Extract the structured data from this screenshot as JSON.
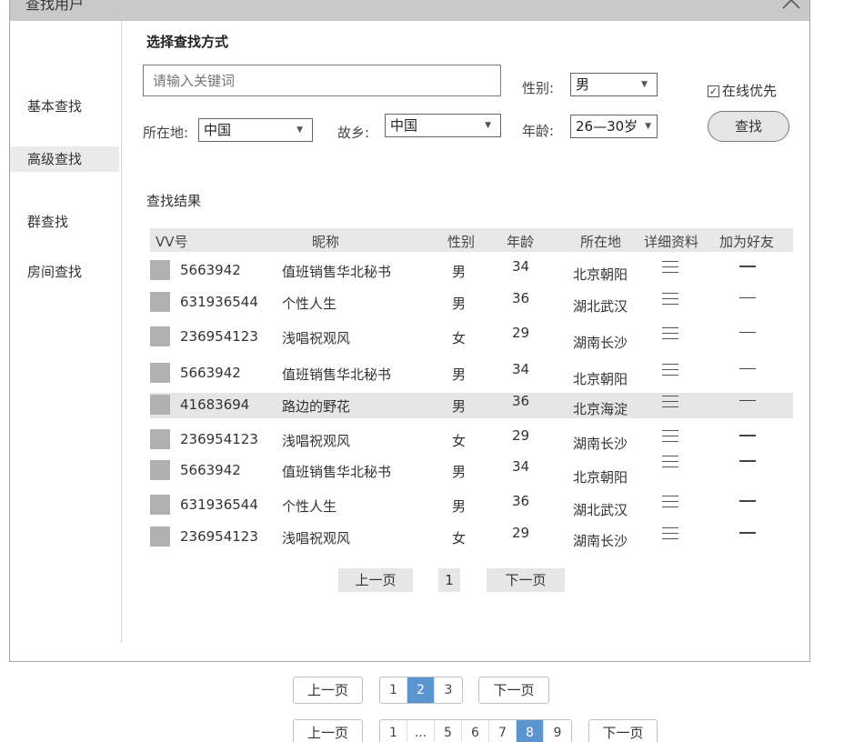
{
  "dialog": {
    "title": "查找用户"
  },
  "sidebar": {
    "items": [
      "基本查找",
      "高级查找",
      "群查找",
      "房间查找"
    ],
    "active": "高级查找"
  },
  "search": {
    "section_title": "选择查找方式",
    "keyword_placeholder": "请输入关键词",
    "gender_label": "性别:",
    "gender_value": "男",
    "location_label": "所在地:",
    "location_value": "中国",
    "hometown_label": "故乡:",
    "hometown_value": "中国",
    "age_label": "年龄:",
    "age_value": "26—30岁",
    "online_first_label": "在线优先",
    "online_first_checked": true,
    "search_button": "查找"
  },
  "results": {
    "title": "查找结果",
    "columns": [
      "VV号",
      "昵称",
      "性别",
      "年龄",
      "所在地",
      "详细资料",
      "加为好友"
    ],
    "rows": [
      {
        "id": "5663942",
        "nick": "值班销售华北秘书",
        "gender": "男",
        "age": "34",
        "loc": "北京朝阳"
      },
      {
        "id": "631936544",
        "nick": "个性人生",
        "gender": "男",
        "age": "36",
        "loc": "湖北武汉"
      },
      {
        "id": "236954123",
        "nick": "浅唱祝观风",
        "gender": "女",
        "age": "29",
        "loc": "湖南长沙"
      },
      {
        "id": "5663942",
        "nick": "值班销售华北秘书",
        "gender": "男",
        "age": "34",
        "loc": "北京朝阳"
      },
      {
        "id": "41683694",
        "nick": "路边的野花",
        "gender": "男",
        "age": "36",
        "loc": "北京海淀"
      },
      {
        "id": "236954123",
        "nick": "浅唱祝观风",
        "gender": "女",
        "age": "29",
        "loc": "湖南长沙"
      },
      {
        "id": "5663942",
        "nick": "值班销售华北秘书",
        "gender": "男",
        "age": "34",
        "loc": "北京朝阳"
      },
      {
        "id": "631936544",
        "nick": "个性人生",
        "gender": "男",
        "age": "36",
        "loc": "湖北武汉"
      },
      {
        "id": "236954123",
        "nick": "浅唱祝观风",
        "gender": "女",
        "age": "29",
        "loc": "湖南长沙"
      }
    ],
    "highlighted_row": 5
  },
  "inner_pager": {
    "prev": "上一页",
    "page": "1",
    "next": "下一页"
  },
  "pager1": {
    "prev": "上一页",
    "pages": [
      "1",
      "2",
      "3"
    ],
    "current": "2",
    "next": "下一页"
  },
  "pager2": {
    "prev": "上一页",
    "pages": [
      "1",
      "...",
      "5",
      "6",
      "7",
      "8",
      "9"
    ],
    "current": "8",
    "next": "下一页"
  },
  "colors": {
    "titlebar": "#c9c9c9",
    "current_page": "#5a95d0",
    "highlight_row": "#e6e6e6"
  }
}
